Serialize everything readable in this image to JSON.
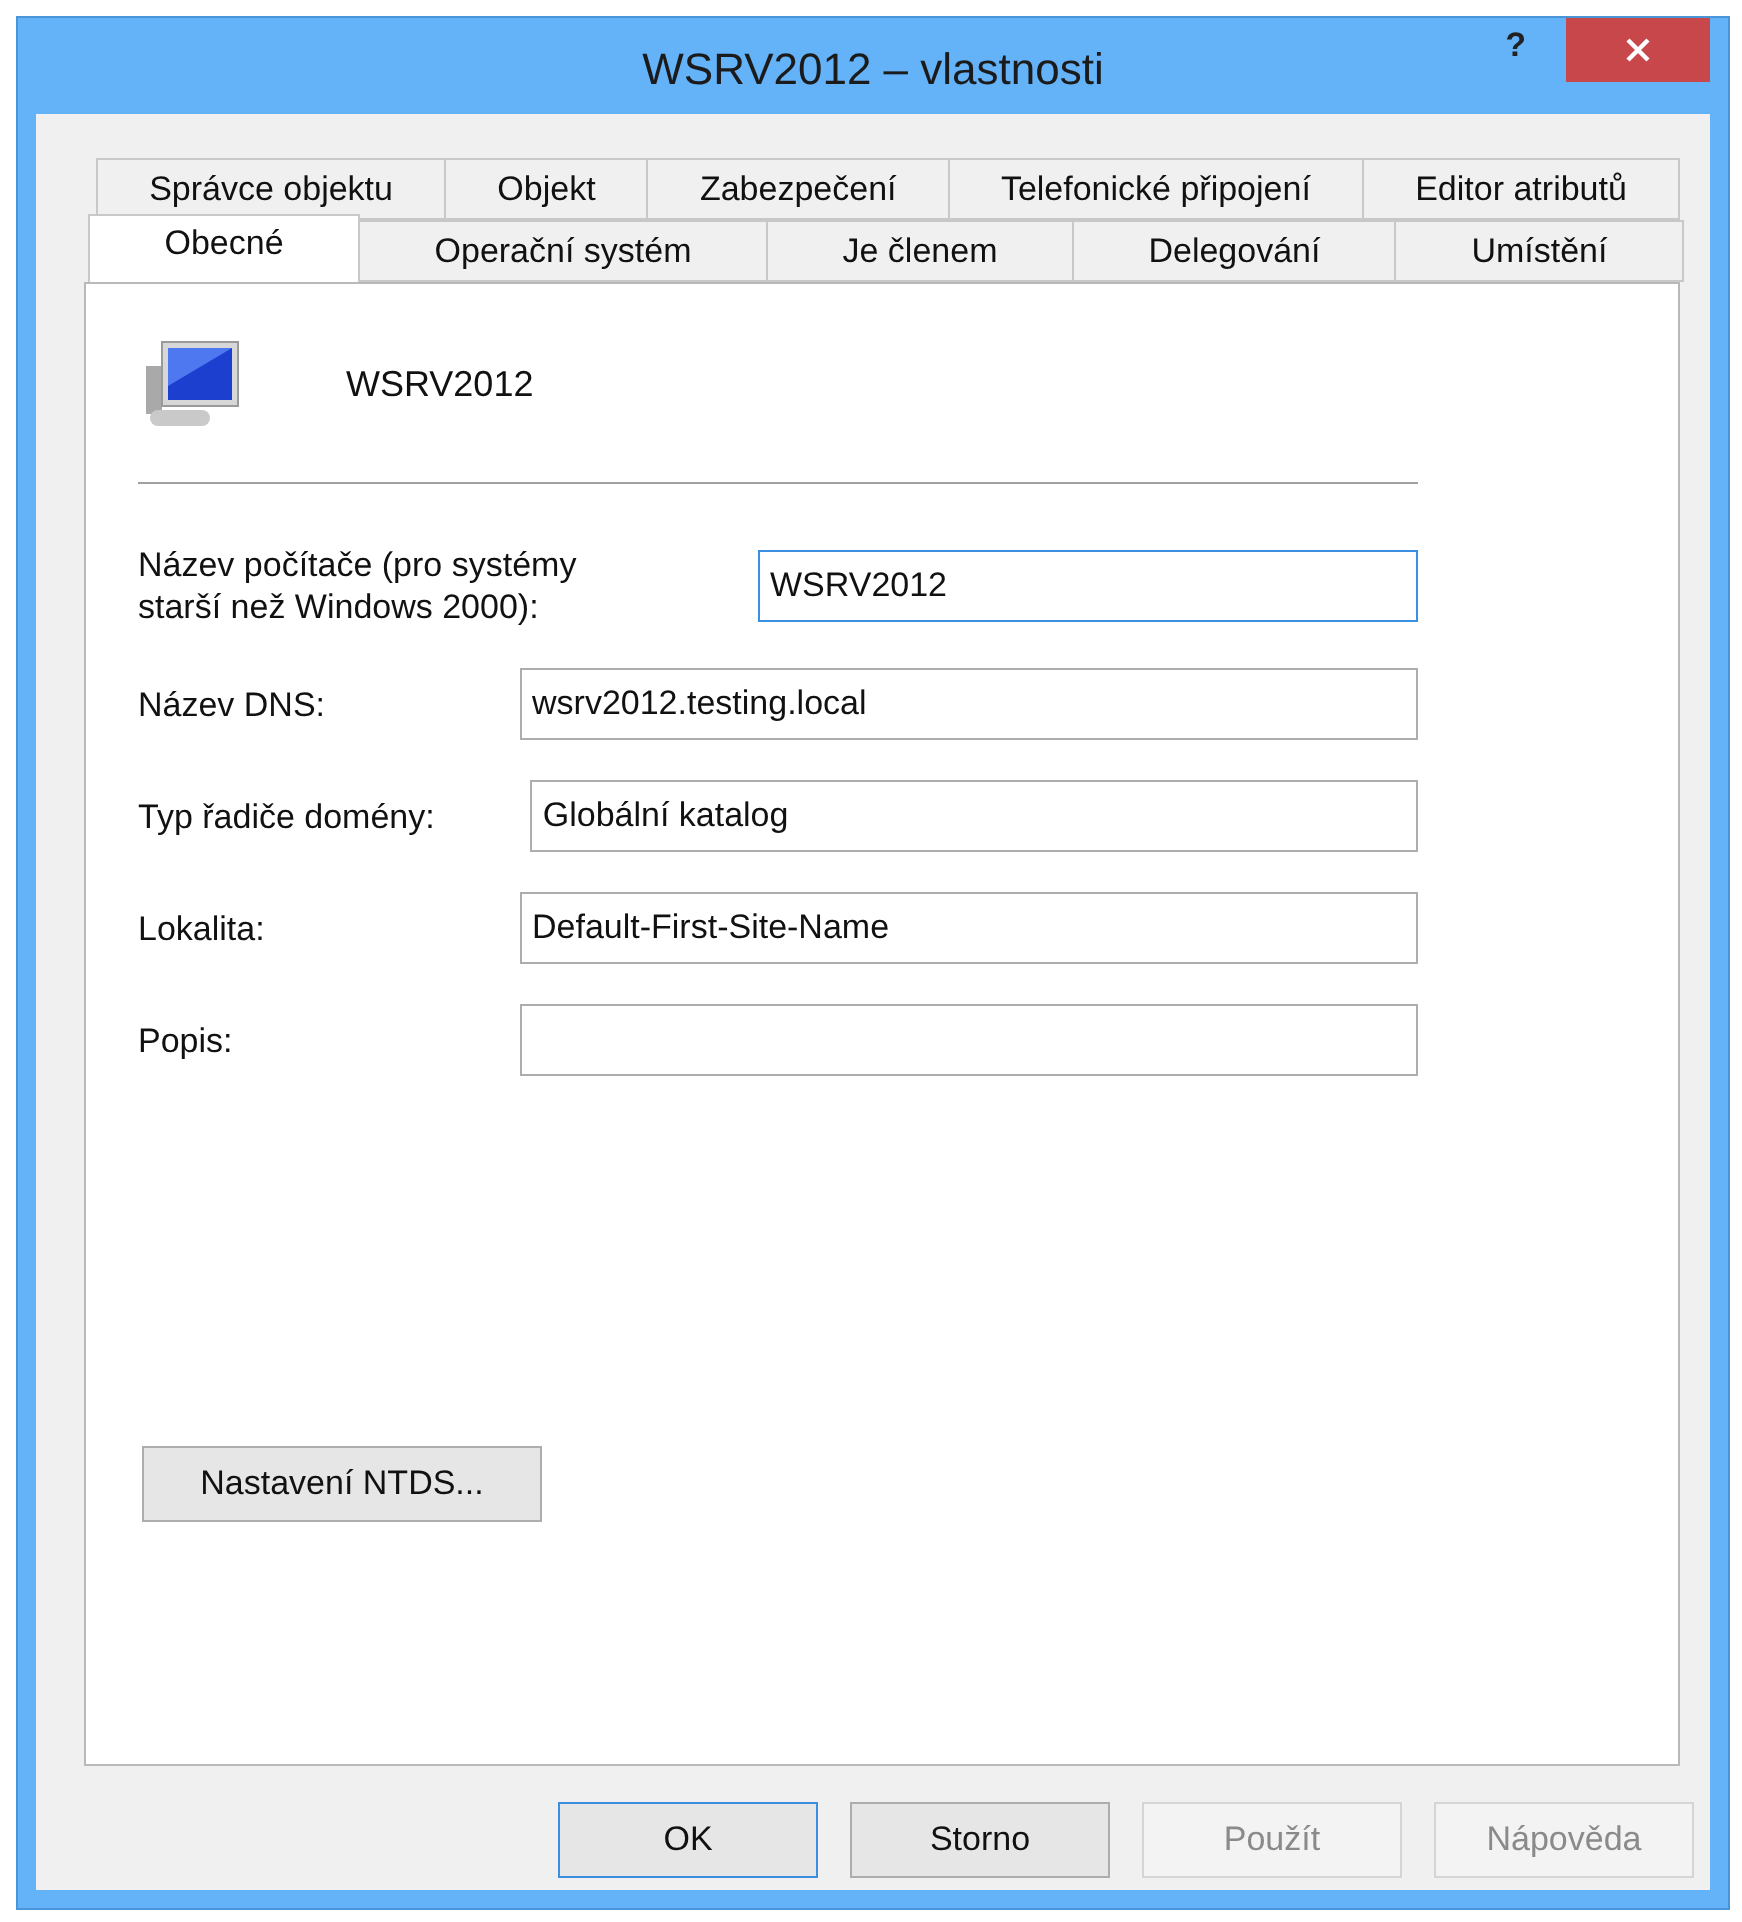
{
  "window": {
    "title": "WSRV2012 – vlastnosti",
    "help": "?"
  },
  "tab_rows": [
    [
      {
        "label": "Správce objektu",
        "selected": false
      },
      {
        "label": "Objekt",
        "selected": false
      },
      {
        "label": "Zabezpečení",
        "selected": false
      },
      {
        "label": "Telefonické připojení",
        "selected": false
      },
      {
        "label": "Editor atributů",
        "selected": false
      }
    ],
    [
      {
        "label": "Obecné",
        "selected": true
      },
      {
        "label": "Operační systém",
        "selected": false
      },
      {
        "label": "Je členem",
        "selected": false
      },
      {
        "label": "Delegování",
        "selected": false
      },
      {
        "label": "Umístění",
        "selected": false
      }
    ]
  ],
  "object_name": "WSRV2012",
  "fields": [
    {
      "label": "Název počítače (pro systémy starší než Windows 2000):",
      "value": "WSRV2012",
      "focused": true
    },
    {
      "label": "Název DNS:",
      "value": "wsrv2012.testing.local",
      "focused": false
    },
    {
      "label": "Typ řadiče domény:",
      "value": "Globální katalog",
      "focused": false
    },
    {
      "label": "Lokalita:",
      "value": "Default-First-Site-Name",
      "focused": false
    },
    {
      "label": "Popis:",
      "focused": false
    }
  ],
  "ntds_button": "Nastavení NTDS...",
  "buttons": [
    {
      "label": "OK",
      "disabled": false,
      "default": true
    },
    {
      "label": "Storno",
      "disabled": false,
      "default": false
    },
    {
      "label": "Použít",
      "disabled": true,
      "default": false
    },
    {
      "label": "Nápověda",
      "disabled": true,
      "default": false
    }
  ]
}
